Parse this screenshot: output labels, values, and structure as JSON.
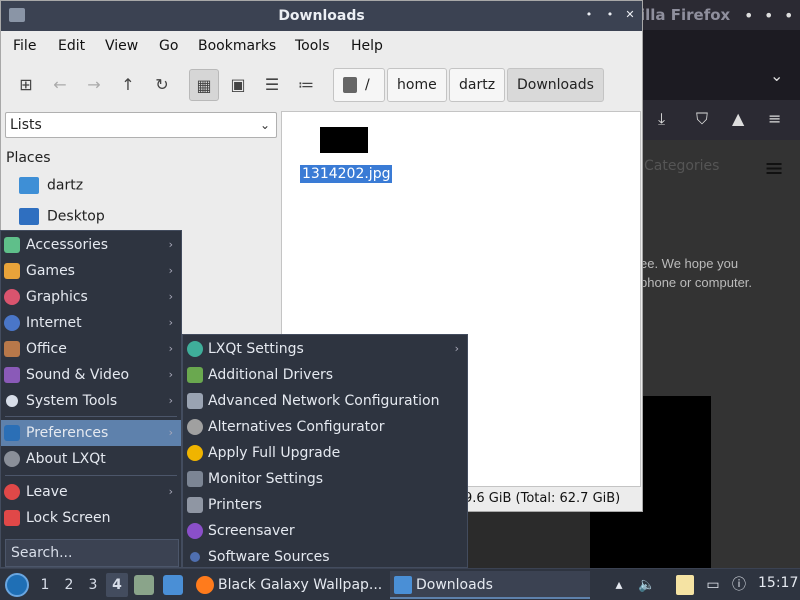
{
  "firefox": {
    "title": "illa Firefox",
    "categories": "Categories",
    "text1": "ee. We hope you",
    "text2": "phone or computer."
  },
  "window": {
    "title": "Downloads",
    "menu": [
      "File",
      "Edit",
      "View",
      "Go",
      "Bookmarks",
      "Tools",
      "Help"
    ],
    "path": [
      "/",
      "home",
      "dartz",
      "Downloads"
    ],
    "sidebar_mode": "Lists",
    "places_header": "Places",
    "places": [
      "dartz",
      "Desktop"
    ],
    "file_name": "1314202.jpg",
    "status": "9.6 GiB (Total: 62.7 GiB)"
  },
  "appmenu": {
    "items": [
      "Accessories",
      "Games",
      "Graphics",
      "Internet",
      "Office",
      "Sound & Video",
      "System Tools",
      "Preferences",
      "About LXQt",
      "Leave",
      "Lock Screen"
    ],
    "search_placeholder": "Search...",
    "selected": "Preferences"
  },
  "submenu": {
    "items": [
      "LXQt Settings",
      "Additional Drivers",
      "Advanced Network Configuration",
      "Alternatives Configurator",
      "Apply Full Upgrade",
      "Monitor Settings",
      "Printers",
      "Screensaver",
      "Software Sources"
    ]
  },
  "taskbar": {
    "desktops": [
      "1",
      "2",
      "3",
      "4"
    ],
    "current_desktop": "4",
    "tasks": [
      "Black Galaxy Wallpap...",
      "Downloads"
    ],
    "clock": "15:17"
  },
  "colors": {
    "menu_bg": "#2e3440",
    "selection": "#5e81ac",
    "file_selection": "#3a7bd5"
  }
}
